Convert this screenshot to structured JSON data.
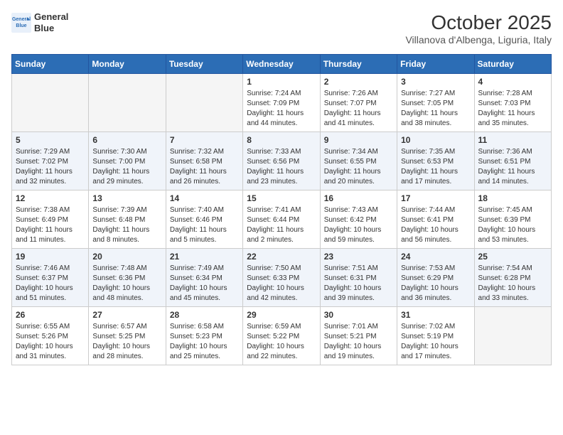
{
  "header": {
    "logo_line1": "General",
    "logo_line2": "Blue",
    "month": "October 2025",
    "location": "Villanova d'Albenga, Liguria, Italy"
  },
  "weekdays": [
    "Sunday",
    "Monday",
    "Tuesday",
    "Wednesday",
    "Thursday",
    "Friday",
    "Saturday"
  ],
  "weeks": [
    [
      {
        "day": "",
        "info": ""
      },
      {
        "day": "",
        "info": ""
      },
      {
        "day": "",
        "info": ""
      },
      {
        "day": "1",
        "info": "Sunrise: 7:24 AM\nSunset: 7:09 PM\nDaylight: 11 hours\nand 44 minutes."
      },
      {
        "day": "2",
        "info": "Sunrise: 7:26 AM\nSunset: 7:07 PM\nDaylight: 11 hours\nand 41 minutes."
      },
      {
        "day": "3",
        "info": "Sunrise: 7:27 AM\nSunset: 7:05 PM\nDaylight: 11 hours\nand 38 minutes."
      },
      {
        "day": "4",
        "info": "Sunrise: 7:28 AM\nSunset: 7:03 PM\nDaylight: 11 hours\nand 35 minutes."
      }
    ],
    [
      {
        "day": "5",
        "info": "Sunrise: 7:29 AM\nSunset: 7:02 PM\nDaylight: 11 hours\nand 32 minutes."
      },
      {
        "day": "6",
        "info": "Sunrise: 7:30 AM\nSunset: 7:00 PM\nDaylight: 11 hours\nand 29 minutes."
      },
      {
        "day": "7",
        "info": "Sunrise: 7:32 AM\nSunset: 6:58 PM\nDaylight: 11 hours\nand 26 minutes."
      },
      {
        "day": "8",
        "info": "Sunrise: 7:33 AM\nSunset: 6:56 PM\nDaylight: 11 hours\nand 23 minutes."
      },
      {
        "day": "9",
        "info": "Sunrise: 7:34 AM\nSunset: 6:55 PM\nDaylight: 11 hours\nand 20 minutes."
      },
      {
        "day": "10",
        "info": "Sunrise: 7:35 AM\nSunset: 6:53 PM\nDaylight: 11 hours\nand 17 minutes."
      },
      {
        "day": "11",
        "info": "Sunrise: 7:36 AM\nSunset: 6:51 PM\nDaylight: 11 hours\nand 14 minutes."
      }
    ],
    [
      {
        "day": "12",
        "info": "Sunrise: 7:38 AM\nSunset: 6:49 PM\nDaylight: 11 hours\nand 11 minutes."
      },
      {
        "day": "13",
        "info": "Sunrise: 7:39 AM\nSunset: 6:48 PM\nDaylight: 11 hours\nand 8 minutes."
      },
      {
        "day": "14",
        "info": "Sunrise: 7:40 AM\nSunset: 6:46 PM\nDaylight: 11 hours\nand 5 minutes."
      },
      {
        "day": "15",
        "info": "Sunrise: 7:41 AM\nSunset: 6:44 PM\nDaylight: 11 hours\nand 2 minutes."
      },
      {
        "day": "16",
        "info": "Sunrise: 7:43 AM\nSunset: 6:42 PM\nDaylight: 10 hours\nand 59 minutes."
      },
      {
        "day": "17",
        "info": "Sunrise: 7:44 AM\nSunset: 6:41 PM\nDaylight: 10 hours\nand 56 minutes."
      },
      {
        "day": "18",
        "info": "Sunrise: 7:45 AM\nSunset: 6:39 PM\nDaylight: 10 hours\nand 53 minutes."
      }
    ],
    [
      {
        "day": "19",
        "info": "Sunrise: 7:46 AM\nSunset: 6:37 PM\nDaylight: 10 hours\nand 51 minutes."
      },
      {
        "day": "20",
        "info": "Sunrise: 7:48 AM\nSunset: 6:36 PM\nDaylight: 10 hours\nand 48 minutes."
      },
      {
        "day": "21",
        "info": "Sunrise: 7:49 AM\nSunset: 6:34 PM\nDaylight: 10 hours\nand 45 minutes."
      },
      {
        "day": "22",
        "info": "Sunrise: 7:50 AM\nSunset: 6:33 PM\nDaylight: 10 hours\nand 42 minutes."
      },
      {
        "day": "23",
        "info": "Sunrise: 7:51 AM\nSunset: 6:31 PM\nDaylight: 10 hours\nand 39 minutes."
      },
      {
        "day": "24",
        "info": "Sunrise: 7:53 AM\nSunset: 6:29 PM\nDaylight: 10 hours\nand 36 minutes."
      },
      {
        "day": "25",
        "info": "Sunrise: 7:54 AM\nSunset: 6:28 PM\nDaylight: 10 hours\nand 33 minutes."
      }
    ],
    [
      {
        "day": "26",
        "info": "Sunrise: 6:55 AM\nSunset: 5:26 PM\nDaylight: 10 hours\nand 31 minutes."
      },
      {
        "day": "27",
        "info": "Sunrise: 6:57 AM\nSunset: 5:25 PM\nDaylight: 10 hours\nand 28 minutes."
      },
      {
        "day": "28",
        "info": "Sunrise: 6:58 AM\nSunset: 5:23 PM\nDaylight: 10 hours\nand 25 minutes."
      },
      {
        "day": "29",
        "info": "Sunrise: 6:59 AM\nSunset: 5:22 PM\nDaylight: 10 hours\nand 22 minutes."
      },
      {
        "day": "30",
        "info": "Sunrise: 7:01 AM\nSunset: 5:21 PM\nDaylight: 10 hours\nand 19 minutes."
      },
      {
        "day": "31",
        "info": "Sunrise: 7:02 AM\nSunset: 5:19 PM\nDaylight: 10 hours\nand 17 minutes."
      },
      {
        "day": "",
        "info": ""
      }
    ]
  ]
}
